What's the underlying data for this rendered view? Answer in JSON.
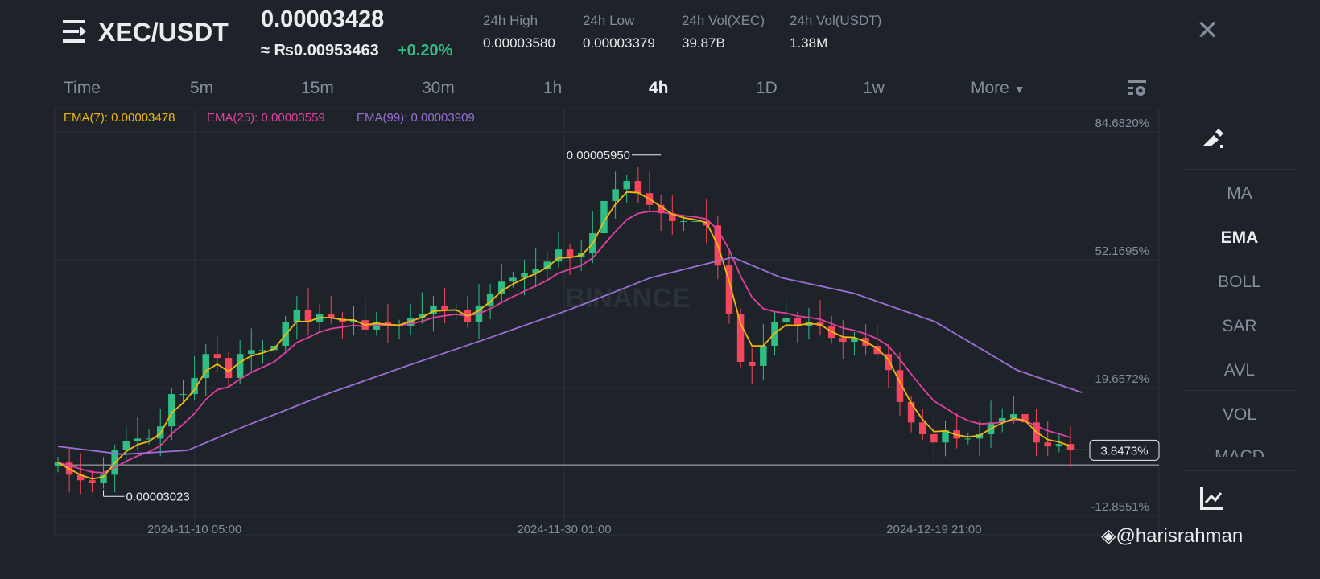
{
  "header": {
    "pair": "XEC/USDT",
    "price": "0.00003428",
    "fiat_price": "≈ ₨0.00953463",
    "change": "+0.20%",
    "stats": [
      {
        "label": "24h High",
        "value": "0.00003580"
      },
      {
        "label": "24h Low",
        "value": "0.00003379"
      },
      {
        "label": "24h Vol(XEC)",
        "value": "39.87B"
      },
      {
        "label": "24h Vol(USDT)",
        "value": "1.38M"
      }
    ]
  },
  "intervals": [
    "Time",
    "5m",
    "15m",
    "30m",
    "1h",
    "4h",
    "1D",
    "1w",
    "More"
  ],
  "active_interval": "4h",
  "indicators_legend": {
    "ema7": "EMA(7): 0.00003478",
    "ema25": "EMA(25): 0.00003559",
    "ema99": "EMA(99): 0.00003909"
  },
  "side_menu": [
    "MA",
    "EMA",
    "BOLL",
    "SAR",
    "AVL",
    "VOL",
    "MACD"
  ],
  "watermark": "BINANCE",
  "credit": "@harisrahman",
  "colors": {
    "up": "#2ebd85",
    "down": "#f6465d",
    "ema7": "#f0b90b",
    "ema25": "#e040a0",
    "ema99": "#9b6fd6"
  },
  "chart_data": {
    "type": "candlestick",
    "y_axis_unit": "%",
    "ylim": [
      -12.8551,
      84.682
    ],
    "y_ticks": [
      "84.6820%",
      "52.1695%",
      "19.6572%",
      "-12.8551%"
    ],
    "y_tick_values": [
      84.682,
      52.1695,
      19.6572,
      -12.8551
    ],
    "x_ticks": [
      {
        "label": "2024-11-10 05:00",
        "index": 12
      },
      {
        "label": "2024-11-30 01:00",
        "index": 44.5
      },
      {
        "label": "2024-12-19 21:00",
        "index": 77
      }
    ],
    "closes": [
      0.6,
      -2.5,
      -3.9,
      -4.5,
      -2.5,
      3.7,
      6.1,
      6.7,
      6.7,
      9.8,
      18.0,
      18.0,
      22.1,
      28.2,
      27.2,
      22.1,
      28.2,
      29.2,
      29.2,
      30.3,
      36.4,
      39.5,
      36.4,
      38.4,
      37.4,
      36.4,
      36.8,
      34.4,
      36.4,
      35.4,
      35.4,
      37.4,
      38.4,
      40.5,
      39.5,
      39.5,
      36.4,
      40.5,
      43.6,
      46.6,
      47.6,
      48.7,
      49.7,
      51.7,
      54.8,
      52.8,
      53.8,
      58.9,
      67.1,
      70.1,
      72.2,
      69.1,
      66.1,
      64.0,
      62.0,
      62.0,
      62.0,
      60.9,
      50.7,
      38.4,
      26.2,
      25.2,
      30.3,
      36.4,
      37.4,
      35.4,
      36.4,
      35.4,
      32.3,
      31.3,
      32.3,
      30.3,
      28.2,
      24.1,
      16.0,
      10.8,
      7.8,
      5.7,
      8.8,
      6.7,
      6.7,
      7.8,
      10.8,
      11.9,
      12.9,
      10.8,
      5.7,
      4.7,
      5.3,
      3.8
    ],
    "ema99_points": [
      [
        0,
        4.7
      ],
      [
        5.7,
        2.7
      ],
      [
        11.4,
        3.7
      ],
      [
        16.4,
        9.8
      ],
      [
        23.6,
        18.0
      ],
      [
        30.7,
        25.2
      ],
      [
        37.9,
        32.3
      ],
      [
        45,
        39.5
      ],
      [
        52.1,
        47.6
      ],
      [
        59.3,
        52.8
      ],
      [
        63.6,
        47.6
      ],
      [
        70,
        43.6
      ],
      [
        77.1,
        36.4
      ],
      [
        84.3,
        24.1
      ],
      [
        90,
        18.4
      ]
    ],
    "high_label": {
      "text": "0.00005950",
      "index": 53,
      "value": 78.8
    },
    "low_label": {
      "text": "0.00003023",
      "index": 4,
      "value": -8.0
    },
    "last_label": "3.8473%",
    "last_value": 3.8473
  }
}
